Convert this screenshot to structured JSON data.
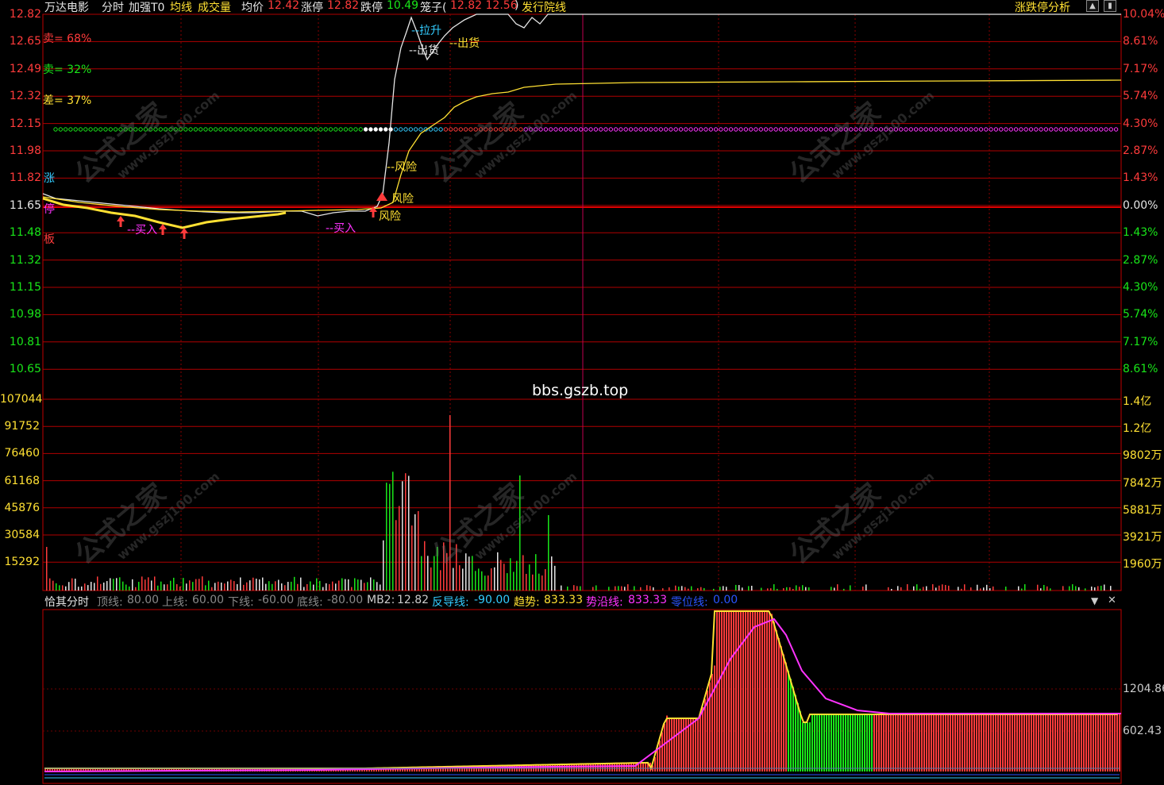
{
  "header": {
    "stock_name": "万达电影",
    "mode": "分时",
    "enhanced": "加强T0",
    "avg_line": "均线",
    "volume": "成交量",
    "avg_price_label": "均价",
    "avg_price_value": "12.42",
    "limit_up_label": "涨停",
    "limit_up_value": "12.82",
    "limit_down_label": "跌停",
    "limit_down_value": "10.49",
    "cage_label": "笼子(",
    "cage_values": "12.82 12.56",
    "cage_close": ")",
    "issue_line": "发行院线",
    "analysis_link": "涨跌停分析",
    "colors": {
      "red": "#ff3b3b",
      "green": "#19e619",
      "yellow": "#ffe033",
      "white": "#e6e6e6",
      "cyan": "#33ccff",
      "magenta": "#ff33ff"
    }
  },
  "price_axis_left": [
    "12.82",
    "12.65",
    "12.49",
    "12.32",
    "12.15",
    "11.98",
    "11.82",
    "11.65",
    "11.48",
    "11.32",
    "11.15",
    "10.98",
    "10.81",
    "10.65"
  ],
  "price_axis_right": [
    "10.04%",
    "8.61%",
    "7.17%",
    "5.74%",
    "4.30%",
    "2.87%",
    "1.43%",
    "0.00%",
    "1.43%",
    "2.87%",
    "4.30%",
    "5.74%",
    "7.17%",
    "8.61%"
  ],
  "volume_axis_left": [
    "107044",
    "91752",
    "76460",
    "61168",
    "45876",
    "30584",
    "15292"
  ],
  "volume_axis_right": [
    "1.4亿",
    "1.2亿",
    "9802万",
    "7842万",
    "5881万",
    "3921万",
    "1960万"
  ],
  "indicators": {
    "sell_1": "卖= 68%",
    "sell_2": "卖= 32%",
    "diff": "差= 37%",
    "side_zhang": "涨",
    "side_ting": "停",
    "side_ban": "板"
  },
  "annotations": {
    "buy_1": "--买入",
    "buy_2": "--买入",
    "risk_1": "--风险",
    "risk_2": "风险",
    "risk_cluster": "风险",
    "lift": "--拉升",
    "ship_1": "--出货",
    "ship_2": "--出货",
    "watermark_url": "bbs.gszb.top"
  },
  "watermarks": {
    "brand": "公式之家",
    "url": "www.gszj100.com"
  },
  "sub_panel": {
    "title": "恰其分时",
    "top_line_label": "顶线:",
    "top_line_value": "80.00",
    "upper_line_label": "上线:",
    "upper_line_value": "60.00",
    "lower_line_label": "下线:",
    "lower_line_value": "-60.00",
    "bottom_line_label": "底线:",
    "bottom_line_value": "-80.00",
    "mb2_label": "MB2:",
    "mb2_value": "12.82",
    "reverse_label": "反导线:",
    "reverse_value": "-90.00",
    "trend_label": "趋势:",
    "trend_value": "833.33",
    "trend_along_label": "势沿线:",
    "trend_along_value": "833.33",
    "zero_label": "零位线:",
    "zero_value": "0.00",
    "axis": [
      "1204.86",
      "602.43"
    ],
    "dropdown_icon": "▼",
    "close_icon": "✕"
  }
}
